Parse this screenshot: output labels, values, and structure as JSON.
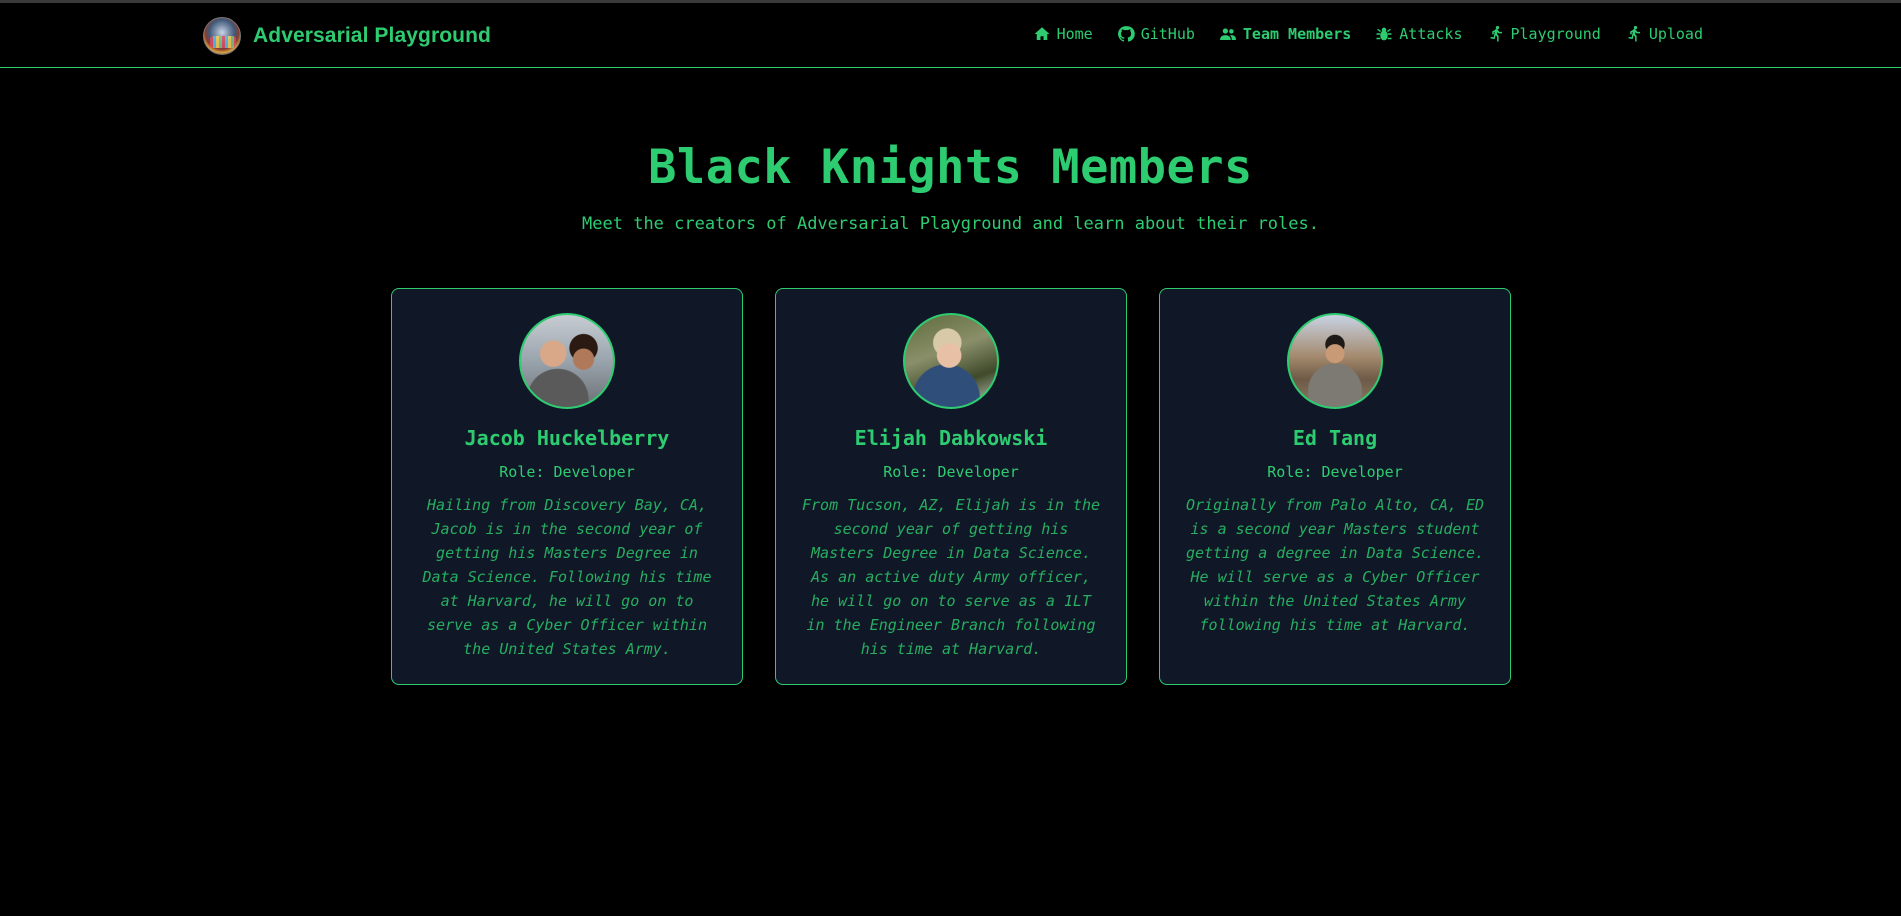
{
  "navbar": {
    "brand_title": "Adversarial Playground",
    "links": [
      {
        "label": "Home",
        "icon": "home-icon"
      },
      {
        "label": "GitHub",
        "icon": "github-icon"
      },
      {
        "label": "Team Members",
        "icon": "users-icon",
        "active": true
      },
      {
        "label": "Attacks",
        "icon": "bug-icon"
      },
      {
        "label": "Playground",
        "icon": "running-icon"
      },
      {
        "label": "Upload",
        "icon": "running-icon"
      }
    ]
  },
  "hero": {
    "title": "Black Knights Members",
    "subtitle": "Meet the creators of Adversarial Playground and learn about their roles."
  },
  "members": [
    {
      "name": "Jacob Huckelberry",
      "role": "Role: Developer",
      "bio": "Hailing from Discovery Bay, CA, Jacob is in the second year of getting his Masters Degree in Data Science. Following his time at Harvard, he will go on to serve as a Cyber Officer within the United States Army."
    },
    {
      "name": "Elijah Dabkowski",
      "role": "Role: Developer",
      "bio": "From Tucson, AZ, Elijah is in the second year of getting his Masters Degree in Data Science. As an active duty Army officer, he will go on to serve as a 1LT in the Engineer Branch following his time at Harvard."
    },
    {
      "name": "Ed Tang",
      "role": "Role: Developer",
      "bio": "Originally from Palo Alto, CA, ED is a second year Masters student getting a degree in Data Science. He will serve as a Cyber Officer within the United States Army following his time at Harvard."
    }
  ],
  "colors": {
    "accent": "#2ecc71",
    "background": "#000000",
    "card_background": "#101827"
  }
}
